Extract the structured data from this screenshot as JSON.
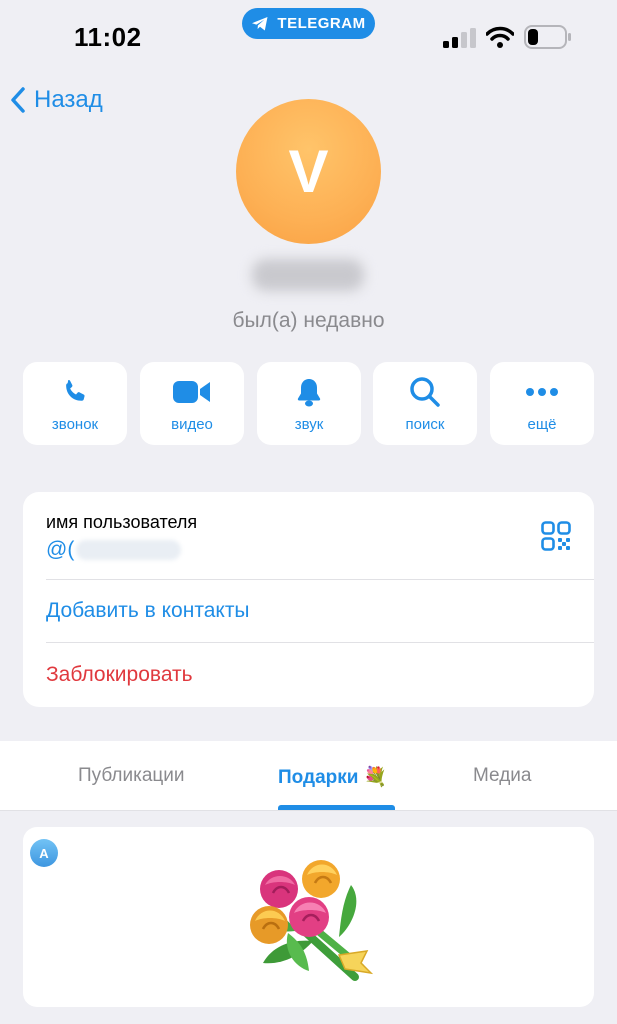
{
  "status_bar": {
    "time": "11:02",
    "app_pill": "TELEGRAM",
    "signal_icon": "cellular-signal-icon",
    "wifi_icon": "wifi-icon",
    "battery_icon": "battery-low-icon"
  },
  "nav": {
    "back_label": "Назад"
  },
  "profile": {
    "avatar_letter": "V",
    "avatar_color": "#fdb054",
    "status": "был(а) недавно"
  },
  "actions": [
    {
      "label": "звонок",
      "icon": "phone-icon"
    },
    {
      "label": "видео",
      "icon": "video-camera-icon"
    },
    {
      "label": "звук",
      "icon": "bell-icon"
    },
    {
      "label": "поиск",
      "icon": "search-icon"
    },
    {
      "label": "ещё",
      "icon": "more-dots-icon"
    }
  ],
  "info": {
    "username_label": "имя пользователя",
    "username_prefix": "@(",
    "add_contact": "Добавить в контакты",
    "block": "Заблокировать"
  },
  "tabs": [
    {
      "label": "Публикации",
      "active": false
    },
    {
      "label": "Подарки 💐",
      "active": true
    },
    {
      "label": "Медиа",
      "active": false
    }
  ],
  "gift": {
    "sender_initial": "A",
    "icon": "bouquet-icon"
  },
  "colors": {
    "accent": "#1f8de6",
    "destructive": "#e0393e",
    "background": "#efeff4"
  }
}
